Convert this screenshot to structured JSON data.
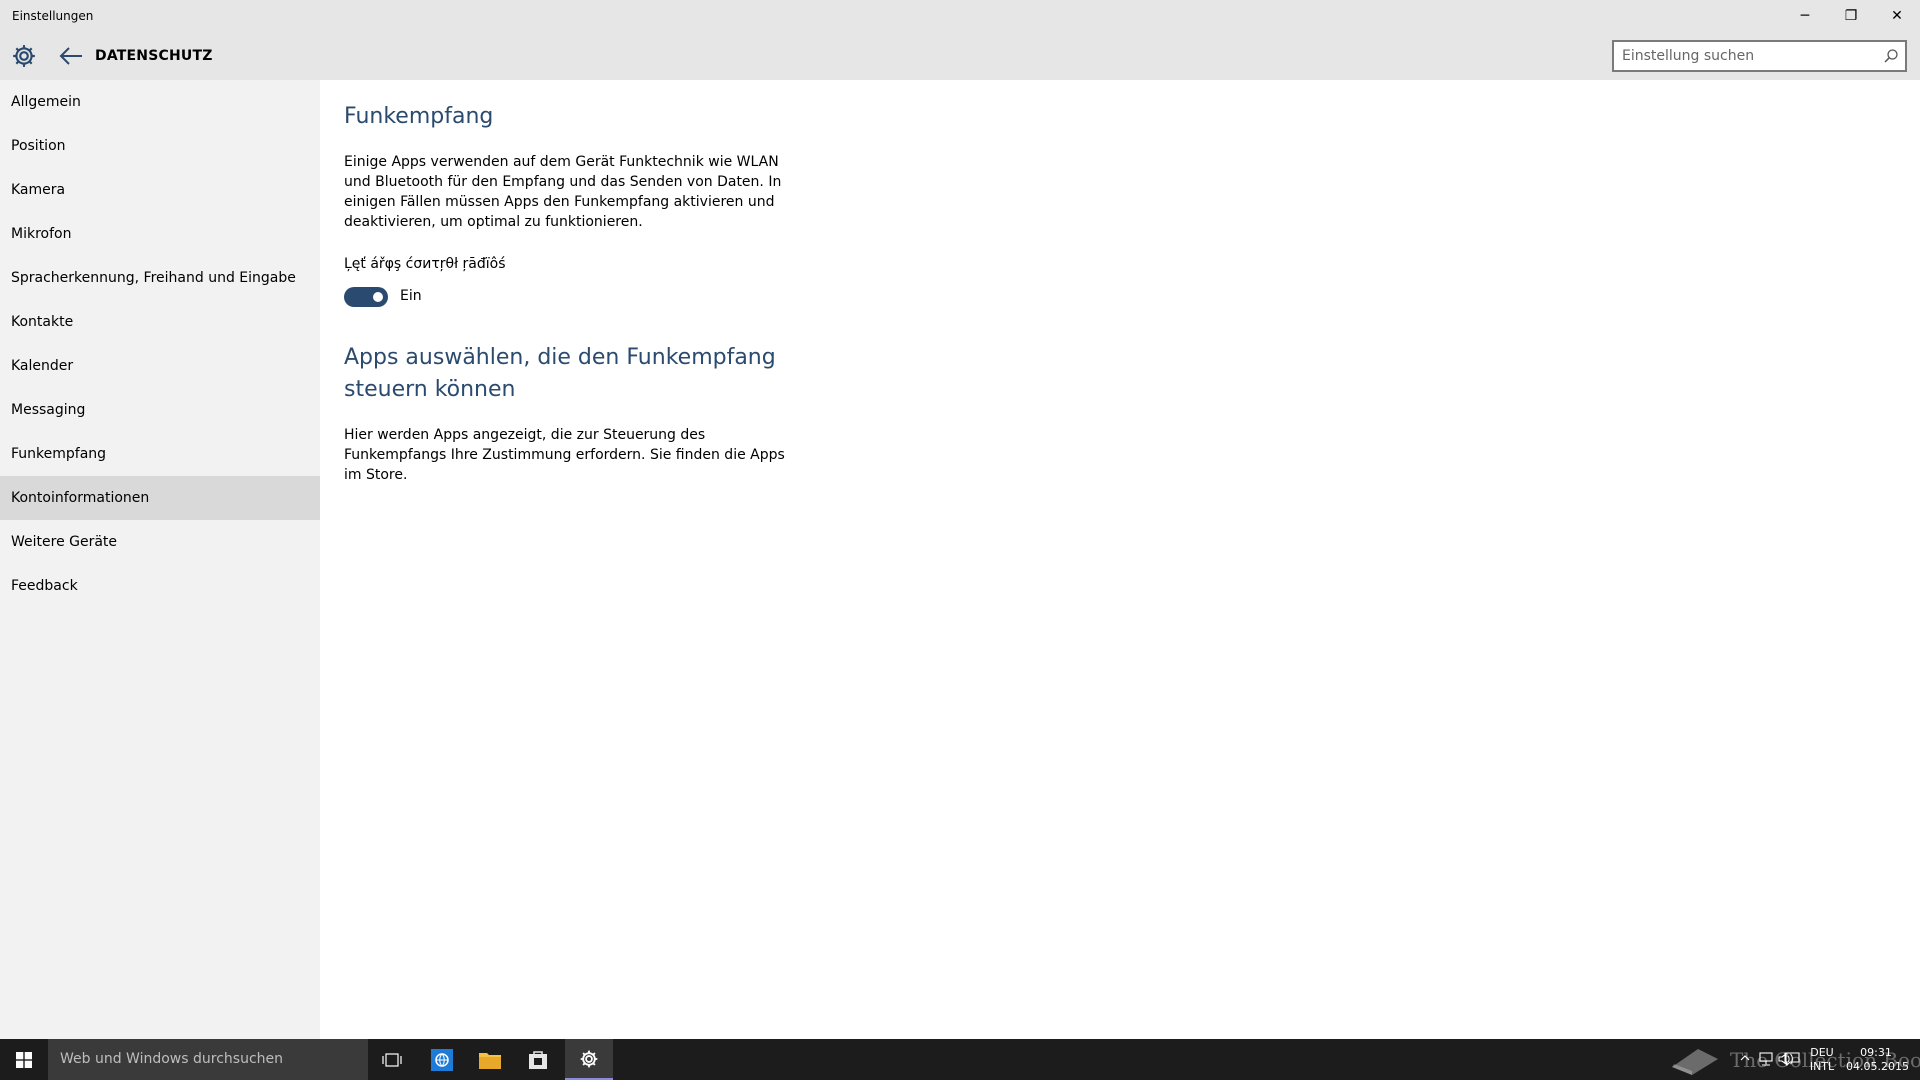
{
  "window": {
    "title": "Einstellungen",
    "minimize_glyph": "─",
    "maximize_glyph": "❐",
    "close_glyph": "✕"
  },
  "header": {
    "title": "DATENSCHUTZ",
    "search_placeholder": "Einstellung suchen"
  },
  "sidebar": {
    "items": [
      {
        "label": "Allgemein"
      },
      {
        "label": "Position"
      },
      {
        "label": "Kamera"
      },
      {
        "label": "Mikrofon"
      },
      {
        "label": "Spracherkennung, Freihand und Eingabe"
      },
      {
        "label": "Kontakte"
      },
      {
        "label": "Kalender"
      },
      {
        "label": "Messaging"
      },
      {
        "label": "Funkempfang"
      },
      {
        "label": "Kontoinformationen"
      },
      {
        "label": "Weitere Geräte"
      },
      {
        "label": "Feedback"
      }
    ],
    "selected_index": 9
  },
  "main": {
    "section_title": "Funkempfang",
    "description": "Einige Apps verwenden auf dem Gerät Funktechnik wie WLAN und Bluetooth für den Empfang und das Senden von Daten. In einigen Fällen müssen Apps den Funkempfang aktivieren und deaktivieren, um optimal zu funktionieren.",
    "toggle_label": "Ļęť ářφş ćσиτŗθł ŗāđïôś",
    "toggle_state": "Ein",
    "toggle_on": true,
    "apps_title": "Apps auswählen, die den Funkempfang steuern können",
    "apps_description": "Hier werden Apps angezeigt, die zur Steuerung des Funkempfangs Ihre Zustimmung erfordern. Sie finden die Apps im Store."
  },
  "taskbar": {
    "search_text": "Web und Windows durchsuchen",
    "watermark": "The Collection Book",
    "language": "DEU",
    "keyboard": "INTL",
    "time": "09:31",
    "date": "04.05.2015"
  },
  "colors": {
    "accent": "#2b4a6f",
    "chrome": "#e6e6e6",
    "sidebar": "#f2f2f2",
    "selected": "#d9d9d9",
    "taskbar": "#1c1c1c"
  }
}
